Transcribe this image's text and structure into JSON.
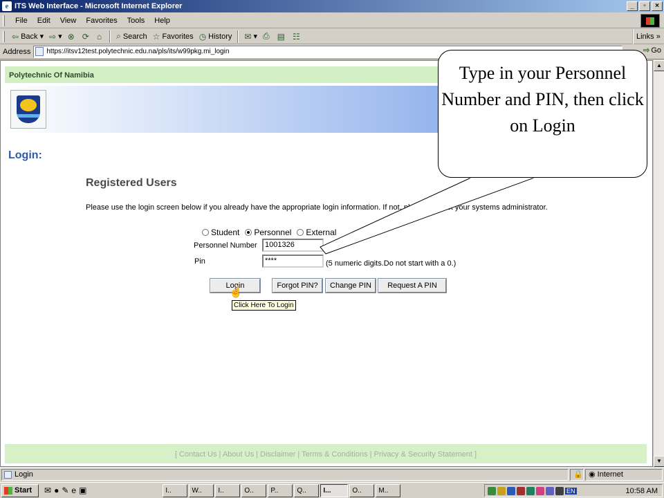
{
  "window": {
    "title": "ITS Web Interface - Microsoft Internet Explorer",
    "controls": [
      "_",
      "▫",
      "×"
    ]
  },
  "menu": [
    "File",
    "Edit",
    "View",
    "Favorites",
    "Tools",
    "Help"
  ],
  "toolbar": {
    "back": "Back",
    "search": "Search",
    "favorites": "Favorites",
    "history": "History",
    "links": "Links"
  },
  "address": {
    "label": "Address",
    "url": "https://itsv12test.polytechnic.edu.na/pls/its/w99pkg.mi_login",
    "go": "Go"
  },
  "page": {
    "site_name": "Polytechnic Of Namibia",
    "heading": "Login:",
    "section_title": "Registered Users",
    "instruction": "Please use the login screen below if you already have the appropriate login information. If not, please contact your systems administrator.",
    "user_types": [
      {
        "label": "Student",
        "selected": false
      },
      {
        "label": "Personnel",
        "selected": true
      },
      {
        "label": "External",
        "selected": false
      }
    ],
    "personnel_label": "Personnel Number",
    "personnel_value": "1001326",
    "pin_label": "Pin",
    "pin_value": "****",
    "pin_hint": "(5 numeric digits.Do not start with a 0.)",
    "buttons": {
      "login": "Login",
      "forgot": "Forgot PIN?",
      "change": "Change PIN",
      "request": "Request A PIN"
    },
    "tooltip": "Click Here To Login",
    "footer": "[ Contact Us | About Us | Disclaimer | Terms & Conditions | Privacy & Security Statement ]"
  },
  "callout": {
    "text": "Type in your Personnel Number and PIN, then click on Login"
  },
  "status": {
    "text": "Login",
    "zone": "Internet"
  },
  "taskbar": {
    "start": "Start",
    "tasks": [
      "I..",
      "W..",
      "I..",
      "O..",
      "P..",
      "Q..",
      "I...",
      "O..",
      "M.."
    ],
    "active_index": 6,
    "lang": "EN",
    "clock": "10:58 AM"
  }
}
